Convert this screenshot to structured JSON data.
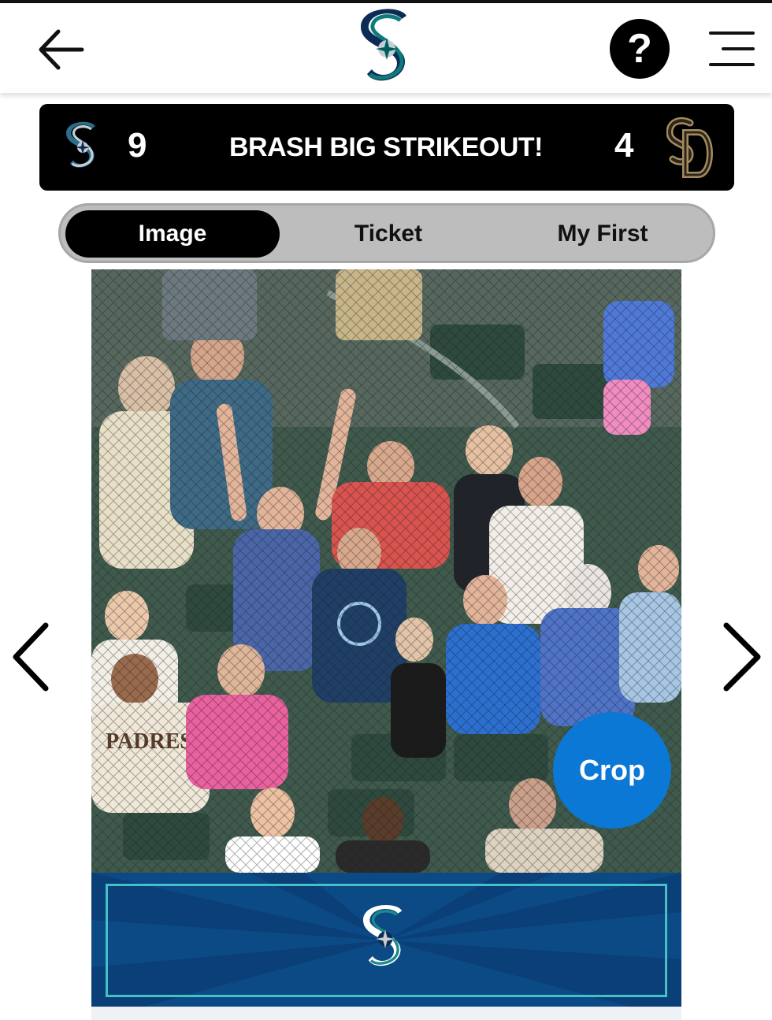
{
  "header": {
    "back_icon": "arrow-left-icon",
    "team_logo": "mariners-s-logo",
    "help_label": "?",
    "menu_icon": "hamburger-menu-icon"
  },
  "scoreboard": {
    "home_score": "9",
    "headline": "BRASH BIG STRIKEOUT!",
    "away_score": "4",
    "home_logo": "mariners-logo",
    "away_logo": "padres-sd-logo"
  },
  "tabs": [
    {
      "label": "Image",
      "active": true
    },
    {
      "label": "Ticket",
      "active": false
    },
    {
      "label": "My First",
      "active": false
    }
  ],
  "photo": {
    "crop_label": "Crop"
  },
  "banner": {
    "logo": "mariners-s-logo"
  },
  "colors": {
    "brand_navy": "#0c2c56",
    "brand_teal": "#005c5c",
    "crop_blue": "#0a78d4",
    "banner_blue": "#0c4a86",
    "padres_brown": "#2f241d",
    "padres_gold": "#a38d5d"
  }
}
